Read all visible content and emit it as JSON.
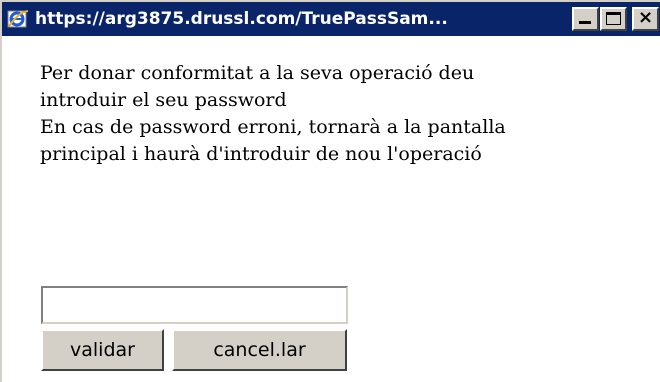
{
  "window": {
    "title": "https://arg3875.drussl.com/TruePassSam..."
  },
  "titlebar_buttons": {
    "minimize_icon": "minimize-icon",
    "maximize_icon": "maximize-icon",
    "close_glyph": "×"
  },
  "dialog": {
    "line1": "Per donar conformitat a la seva operació deu",
    "line2": "introduir el seu password",
    "line3": "En cas de password erroni, tornarà a la pantalla",
    "line4": "principal i haurà d'introduir de nou l'operació"
  },
  "form": {
    "password_value": "",
    "validate_label": "validar",
    "cancel_label": "cancel.lar"
  },
  "colors": {
    "titlebar": "#0a246a",
    "button_face": "#d4d0c8",
    "title_text": "#ffffff"
  }
}
